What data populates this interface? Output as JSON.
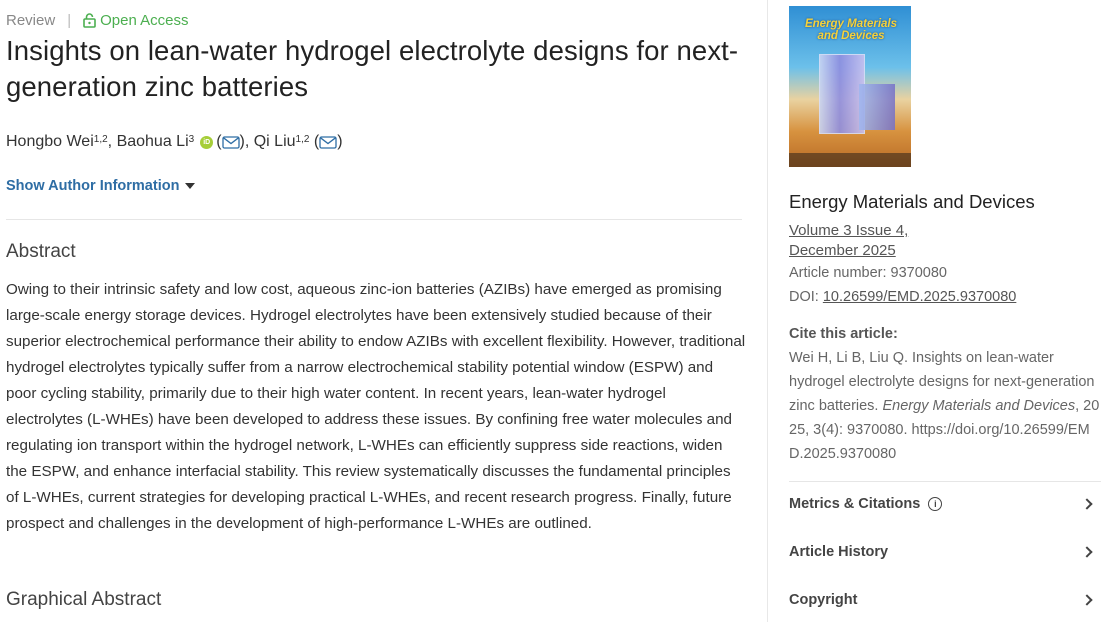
{
  "article": {
    "type": "Review",
    "access": "Open Access",
    "title": "Insights on lean-water hydrogel electrolyte designs for next-generation zinc batteries",
    "authors": [
      {
        "name": "Hongbo Wei",
        "aff": "1,2"
      },
      {
        "name": "Baohua Li",
        "aff": "3"
      },
      {
        "name": "Qi Liu",
        "aff": "1,2"
      }
    ],
    "show_author_info": "Show Author Information",
    "abstract_heading": "Abstract",
    "abstract": "Owing to their intrinsic safety and low cost, aqueous zinc-ion batteries (AZIBs) have emerged as promising large-scale energy storage devices. Hydrogel electrolytes have been extensively studied because of their superior electrochemical performance their ability to endow AZIBs with excellent flexibility. However, traditional hydrogel electrolytes typically suffer from a narrow electrochemical stability potential window (ESPW) and poor cycling stability, primarily due to their high water content. In recent years, lean-water hydrogel electrolytes (L-WHEs) have been developed to address these issues. By confining free water molecules and regulating ion transport within the hydrogel network, L-WHEs can efficiently suppress side reactions, widen the ESPW, and enhance interfacial stability. This review systematically discusses the fundamental principles of L-WHEs, current strategies for developing practical L-WHEs, and recent research progress. Finally, future prospect and challenges in the development of high-performance L-WHEs are outlined.",
    "graphical_abstract_heading": "Graphical Abstract"
  },
  "sidebar": {
    "cover": {
      "title_line1": "Energy Materials",
      "title_line2": "and Devices"
    },
    "journal": "Energy Materials and Devices",
    "volume_line1": "Volume 3 Issue 4,",
    "volume_line2": "December 2025",
    "article_number": "Article number: 9370080",
    "doi_label": "DOI: ",
    "doi": "10.26599/EMD.2025.9370080",
    "cite_heading": "Cite this article:",
    "cite_pre": "Wei H, Li B, Liu Q. Insights on lean-water hydrogel electrolyte designs for next-generation zinc batteries. ",
    "cite_journal": "Energy Materials and Devices",
    "cite_post": ", 2025, 3(4): 9370080. https://doi.org/10.26599/EMD.2025.9370080",
    "sections": [
      "Metrics & Citations",
      "Article History",
      "Copyright"
    ]
  },
  "colors": {
    "open_access": "#4caf50",
    "link": "#2e6da4",
    "orcid": "#a6ce39"
  }
}
